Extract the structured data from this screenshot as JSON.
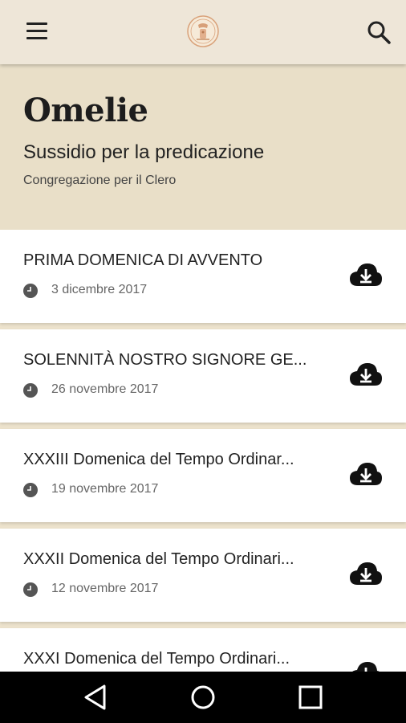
{
  "appbar": {
    "menu_icon": "hamburger-menu-icon",
    "logo_icon": "seal-logo",
    "search_icon": "search-icon"
  },
  "header": {
    "title": "Omelie",
    "subtitle": "Sussidio per la predicazione",
    "author": "Congregazione per il Clero"
  },
  "homilies": [
    {
      "title": "PRIMA DOMENICA DI AVVENTO",
      "date": "3 dicembre 2017"
    },
    {
      "title": "SOLENNITÀ NOSTRO SIGNORE GE...",
      "date": "26 novembre 2017"
    },
    {
      "title": "XXXIII Domenica del Tempo Ordinar...",
      "date": "19 novembre 2017"
    },
    {
      "title": "XXXII Domenica del Tempo Ordinari...",
      "date": "12 novembre 2017"
    },
    {
      "title": "XXXI Domenica del Tempo Ordinari...",
      "date": ""
    }
  ],
  "icons": {
    "date": "clock-icon",
    "download": "cloud-download-icon"
  },
  "system_nav": {
    "back": "back-triangle-icon",
    "home": "home-circle-icon",
    "recents": "recents-square-icon"
  },
  "colors": {
    "appbar": "#eee6d8",
    "hero": "#e9dfc8",
    "card": "#ffffff",
    "separator": "#ece2cc",
    "nav": "#000000"
  }
}
